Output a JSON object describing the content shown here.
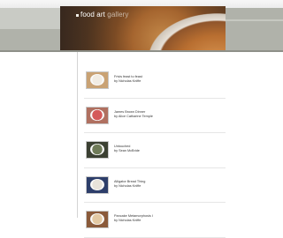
{
  "site": {
    "logo_word_bold": "food art",
    "logo_word_light": "gallery"
  },
  "items": [
    {
      "title": "Frivis feast to feast",
      "author": "by Nicholas Kniffe",
      "thumb_bg": "#c9a274",
      "plate_color": "#f1ece3"
    },
    {
      "title": "James Brown Dinner",
      "author": "by Alice Catharine Temple",
      "thumb_bg": "#b07060",
      "plate_color": "#d45a5a"
    },
    {
      "title": "Untouched",
      "author": "by Sean McBride",
      "thumb_bg": "#3b4032",
      "plate_color": "#6f7b58"
    },
    {
      "title": "Alligator Bread Thing",
      "author": "by Nicholas Kniffe",
      "thumb_bg": "#2d3e6a",
      "plate_color": "#e8e3da"
    },
    {
      "title": "Pancake Metamorphosis I",
      "author": "by Nicholas Kniffe",
      "thumb_bg": "#8a5a3a",
      "plate_color": "#e3c9a3"
    }
  ]
}
